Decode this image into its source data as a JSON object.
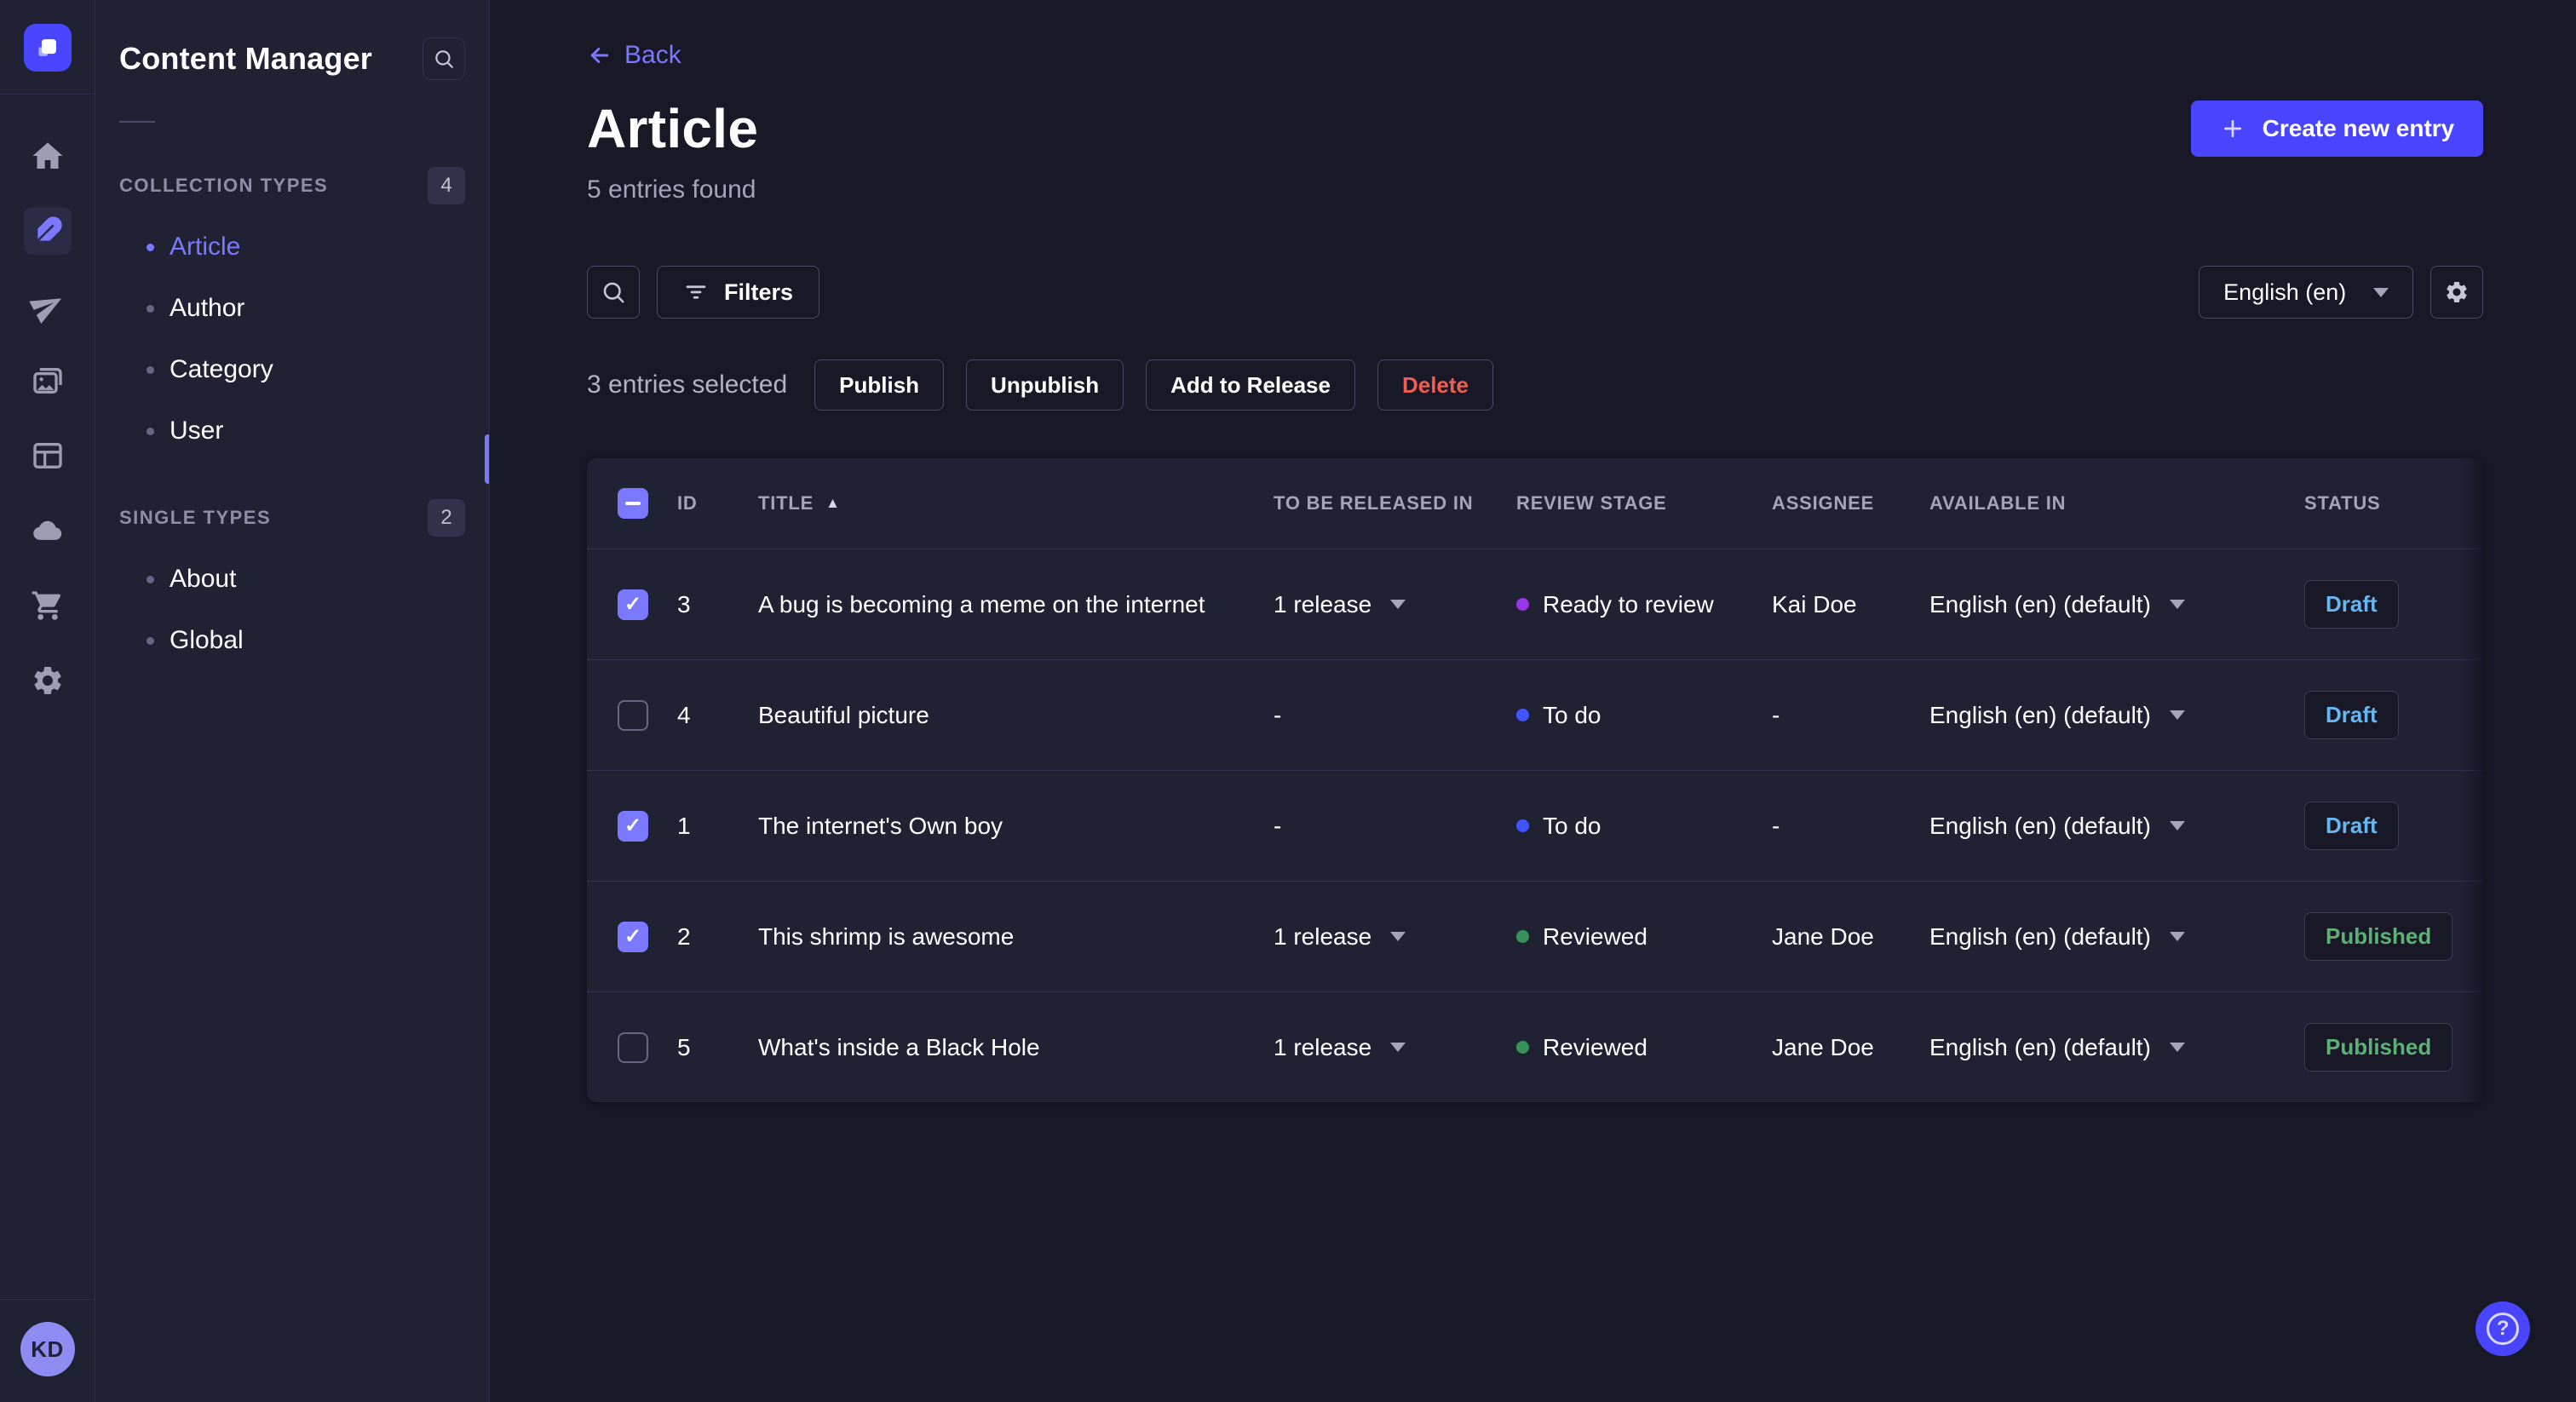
{
  "colors": {
    "accent": "#4945ff",
    "accent_light": "#7b79ff",
    "background": "#181826",
    "surface": "#212134",
    "draft_text": "#66b7f1",
    "published_text": "#5cb176",
    "danger_text": "#ee5e52",
    "stage_ready_dot": "#9736e8",
    "stage_todo_dot": "#4055ff",
    "stage_reviewed_dot": "#37935a"
  },
  "rail": {
    "avatar_initials": "KD"
  },
  "sidebar": {
    "title": "Content Manager",
    "sections": [
      {
        "label": "COLLECTION TYPES",
        "count": "4",
        "items": [
          {
            "label": "Article"
          },
          {
            "label": "Author"
          },
          {
            "label": "Category"
          },
          {
            "label": "User"
          }
        ]
      },
      {
        "label": "SINGLE TYPES",
        "count": "2",
        "items": [
          {
            "label": "About"
          },
          {
            "label": "Global"
          }
        ]
      }
    ]
  },
  "header": {
    "back_label": "Back",
    "title": "Article",
    "subtitle": "5 entries found",
    "create_label": "Create new entry"
  },
  "toolbar": {
    "filters_label": "Filters",
    "locale_value": "English (en)"
  },
  "selection": {
    "summary": "3 entries selected",
    "publish_label": "Publish",
    "unpublish_label": "Unpublish",
    "add_to_release_label": "Add to Release",
    "delete_label": "Delete"
  },
  "table": {
    "columns": {
      "id": "ID",
      "title": "TITLE",
      "released": "TO BE RELEASED IN",
      "stage": "REVIEW STAGE",
      "assignee": "ASSIGNEE",
      "available": "AVAILABLE IN",
      "status": "STATUS"
    },
    "rows": [
      {
        "checked": "checked",
        "id": "3",
        "title": "A bug is becoming a meme on the internet",
        "release": "1 release",
        "release_menu": "has-menu",
        "stage": "Ready to review",
        "stage_tone": "tone-ready",
        "assignee": "Kai Doe",
        "available": "English (en) (default)",
        "status": "Draft",
        "status_tone": "tone-draft"
      },
      {
        "checked": "unchecked",
        "id": "4",
        "title": "Beautiful picture",
        "release": "-",
        "release_menu": "no-menu",
        "stage": "To do",
        "stage_tone": "tone-todo",
        "assignee": "-",
        "available": "English (en) (default)",
        "status": "Draft",
        "status_tone": "tone-draft"
      },
      {
        "checked": "checked",
        "id": "1",
        "title": "The internet's Own boy",
        "release": "-",
        "release_menu": "no-menu",
        "stage": "To do",
        "stage_tone": "tone-todo",
        "assignee": "-",
        "available": "English (en) (default)",
        "status": "Draft",
        "status_tone": "tone-draft"
      },
      {
        "checked": "checked",
        "id": "2",
        "title": "This shrimp is awesome",
        "release": "1 release",
        "release_menu": "has-menu",
        "stage": "Reviewed",
        "stage_tone": "tone-reviewed",
        "assignee": "Jane Doe",
        "available": "English (en) (default)",
        "status": "Published",
        "status_tone": "tone-published"
      },
      {
        "checked": "unchecked",
        "id": "5",
        "title": "What's inside a Black Hole",
        "release": "1 release",
        "release_menu": "has-menu",
        "stage": "Reviewed",
        "stage_tone": "tone-reviewed",
        "assignee": "Jane Doe",
        "available": "English (en) (default)",
        "status": "Published",
        "status_tone": "tone-published"
      }
    ]
  }
}
